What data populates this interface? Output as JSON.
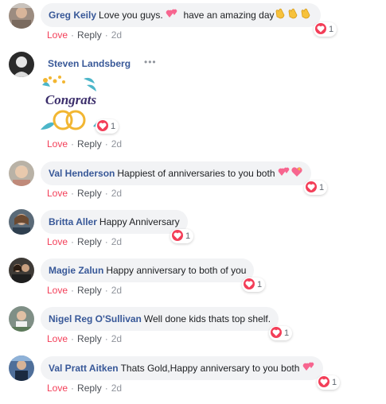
{
  "comments": [
    {
      "name": "Greg Keily",
      "text": "Love you guys.",
      "text2": "have an amazing day",
      "reaction_count": "1",
      "love": "Love",
      "reply": "Reply",
      "time": "2d"
    },
    {
      "name": "Steven Landsberg",
      "sticker_text": "Congrats",
      "reaction_count": "1",
      "love": "Love",
      "reply": "Reply",
      "time": "2d"
    },
    {
      "name": "Val Henderson",
      "text": "Happiest of anniversaries to you both",
      "reaction_count": "1",
      "love": "Love",
      "reply": "Reply",
      "time": "2d"
    },
    {
      "name": "Britta Aller",
      "text": "Happy Anniversary",
      "reaction_count": "1",
      "love": "Love",
      "reply": "Reply",
      "time": "2d"
    },
    {
      "name": "Magie Zalun",
      "text": "Happy anniversary to both of you",
      "reaction_count": "1",
      "love": "Love",
      "reply": "Reply",
      "time": "2d"
    },
    {
      "name": "Nigel Reg O'Sullivan",
      "text": "Well done kids thats top shelf.",
      "reaction_count": "1",
      "love": "Love",
      "reply": "Reply",
      "time": "2d"
    },
    {
      "name": "Val Pratt Aitken",
      "text": "Thats Gold,Happy anniversary to you both",
      "reaction_count": "1",
      "love": "Love",
      "reply": "Reply",
      "time": "2d"
    }
  ],
  "colors": {
    "name": "#385898",
    "love": "#f33e58",
    "bubble": "#f2f3f5",
    "meta": "#90949c"
  },
  "icons": [
    "heart-reaction-icon",
    "two-hearts-icon",
    "clapping-hands-icon",
    "more-options-icon",
    "wedding-rings-icon"
  ]
}
